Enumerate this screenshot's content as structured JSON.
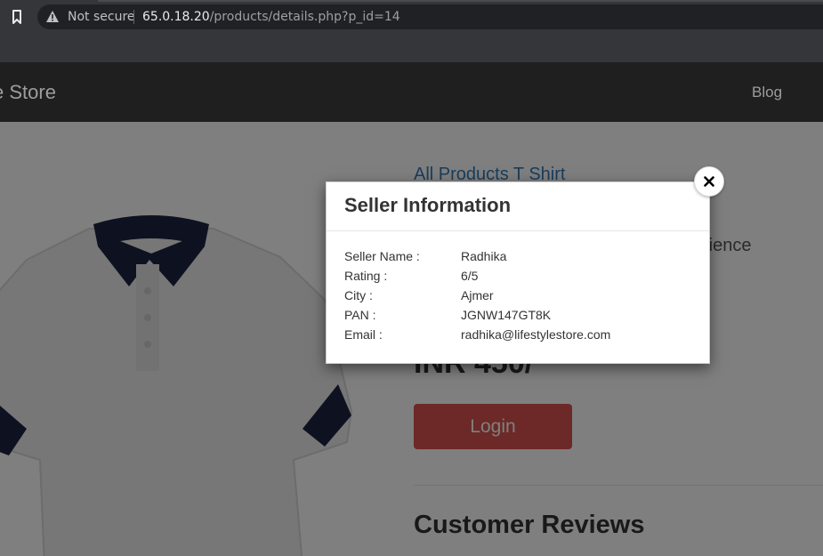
{
  "browser": {
    "security_label": "Not secure",
    "url_host": "65.0.18.20",
    "url_path": "/products/details.php?p_id=14"
  },
  "navbar": {
    "brand": "e Store",
    "blog_link": "Blog"
  },
  "product": {
    "title": "All Products T Shirt",
    "description_fragment": "rience",
    "price": "INR 450/",
    "login_button": "Login",
    "reviews_heading": "Customer Reviews"
  },
  "modal": {
    "title": "Seller Information",
    "fields": [
      {
        "label": "Seller Name :",
        "value": "Radhika"
      },
      {
        "label": "Rating :",
        "value": "6/5"
      },
      {
        "label": "City :",
        "value": "Ajmer"
      },
      {
        "label": "PAN :",
        "value": "JGNW147GT8K"
      },
      {
        "label": "Email :",
        "value": "radhika@lifestylestore.com"
      }
    ],
    "close_icon": "close-icon"
  },
  "colors": {
    "navbar_bg": "#1f1f1f",
    "link_blue": "#337ab7",
    "login_red": "#d9534f",
    "browser_bg": "#35363a"
  }
}
